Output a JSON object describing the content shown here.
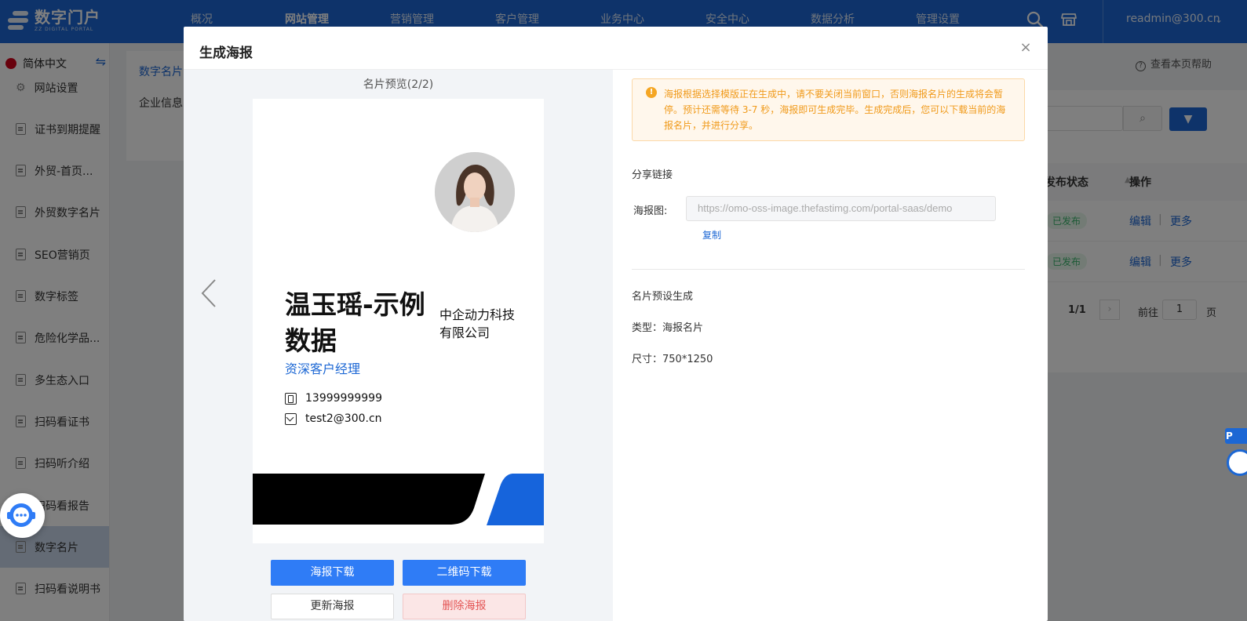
{
  "app": {
    "logo_title": "数字门户",
    "logo_subtitle": "ZZ DIGITAL PORTAL",
    "user": "readmin@300.cn",
    "nav": [
      "概况",
      "网站管理",
      "营销管理",
      "客户管理",
      "业务中心",
      "安全中心",
      "数据分析",
      "管理设置"
    ],
    "nav_active_index": 1,
    "colors": {
      "brand": "#1c67d4",
      "primary_button": "#2f7cf6",
      "warning": "#f09a1a",
      "danger": "#e45656",
      "success": "#3bb56d"
    }
  },
  "sidebar": {
    "language": "简体中文",
    "items": [
      {
        "label": "网站设置",
        "icon": "gear-icon"
      },
      {
        "label": "证书到期提醒",
        "icon": "document-icon"
      },
      {
        "label": "外贸-首页...",
        "icon": "document-icon"
      },
      {
        "label": "外贸数字名片",
        "icon": "document-icon"
      },
      {
        "label": "SEO营销页",
        "icon": "document-icon"
      },
      {
        "label": "数字标签",
        "icon": "document-icon"
      },
      {
        "label": "危险化学品...",
        "icon": "document-icon"
      },
      {
        "label": "多生态入口",
        "icon": "document-icon"
      },
      {
        "label": "扫码看证书",
        "icon": "document-icon"
      },
      {
        "label": "扫码听介绍",
        "icon": "document-icon"
      },
      {
        "label": "扫码看报告",
        "icon": "document-icon"
      },
      {
        "label": "数字名片",
        "icon": "document-icon"
      },
      {
        "label": "扫码看说明书",
        "icon": "document-icon"
      }
    ],
    "active_index": 11
  },
  "background_page": {
    "subtabs": [
      "数字名片",
      "企业信息"
    ],
    "help": "查看本页帮助",
    "table_headers": [
      "发布状态",
      "操作"
    ],
    "rows": [
      {
        "status": "已发布",
        "edit": "编辑",
        "more": "更多"
      },
      {
        "status": "已发布",
        "edit": "编辑",
        "more": "更多"
      }
    ],
    "pager": {
      "pages": "1/1",
      "goto_label": "前往",
      "goto_value": "1",
      "page_suffix": "页"
    }
  },
  "modal": {
    "title": "生成海报",
    "preview_label": "名片预览(2/2)",
    "card": {
      "name": "温玉瑶-示例数据",
      "company": "中企动力科技有限公司",
      "job_title": "资深客户经理",
      "phone": "13999999999",
      "email": "test2@300.cn"
    },
    "buttons": {
      "download_poster": "海报下载",
      "download_qr": "二维码下载",
      "update_poster": "更新海报",
      "delete_poster": "删除海报"
    },
    "alert": "海报根据选择模版正在生成中，请不要关闭当前窗口，否则海报名片的生成将会暂停。预计还需等待 3-7 秒，海报即可生成完毕。生成完成后，您可以下载当前的海报名片，并进行分享。",
    "share_section": "分享链接",
    "poster_label": "海报图:",
    "poster_url": "https://omo-oss-image.thefastimg.com/portal-saas/demo",
    "copy_label": "复制",
    "preset_section": "名片预设生成",
    "type_text": "类型：海报名片",
    "size_text": "尺寸：750*1250"
  },
  "edge_tag": "P"
}
